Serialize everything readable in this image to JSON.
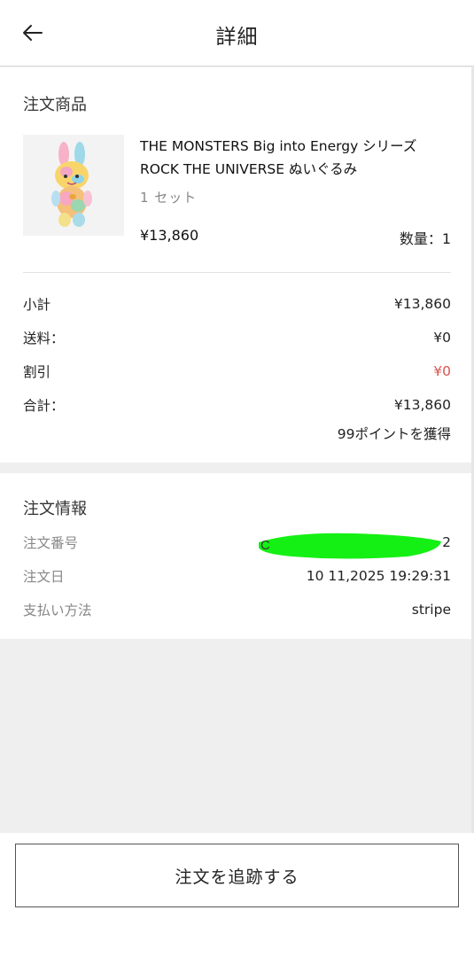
{
  "header": {
    "title": "詳細",
    "back_icon": "arrow-left-icon"
  },
  "products": {
    "section_title": "注文商品",
    "item": {
      "name": "THE MONSTERS Big into Energy シリーズ ROCK THE UNIVERSE ぬいぐるみ",
      "variant": "1 セット",
      "price": "¥13,860",
      "quantity": "数量：1"
    }
  },
  "summary": {
    "subtotal_label": "小計",
    "subtotal_value": "¥13,860",
    "shipping_label": "送料：",
    "shipping_value": "¥0",
    "discount_label": "割引",
    "discount_value": "¥0",
    "total_label": "合計：",
    "total_value": "¥13,860",
    "points": "99ポイントを獲得"
  },
  "order_info": {
    "section_title": "注文情報",
    "order_number_label": "注文番号",
    "order_number_value_visible_end": "2",
    "order_number_value_visible_start": "C",
    "order_date_label": "注文日",
    "order_date_value": "10 11,2025 19:29:31",
    "payment_label": "支払い方法",
    "payment_value": "stripe"
  },
  "footer": {
    "track_button_label": "注文を追跡する"
  },
  "colors": {
    "discount_red": "#d9534f",
    "redaction_green": "#14f014"
  }
}
